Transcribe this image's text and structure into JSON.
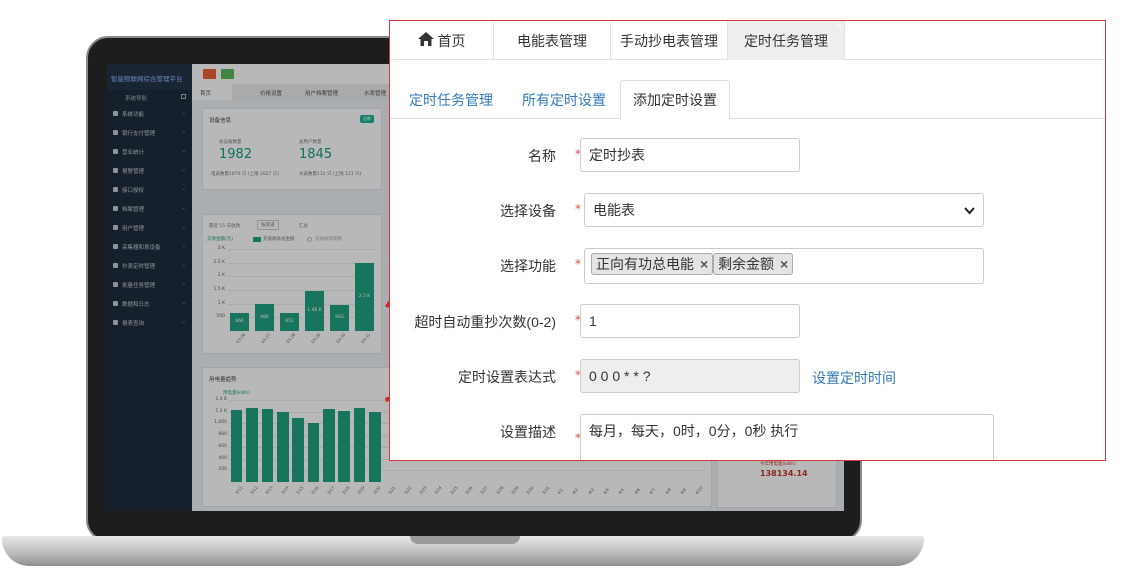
{
  "dashboard": {
    "brand": "智能物联网综合管理平台",
    "nav_header": "系统导航",
    "sidebar_items": [
      "系统功能",
      "银行支付管理",
      "营业统计",
      "报警管理",
      "接口授权",
      "档案管理",
      "用户管理",
      "采集器和表设备",
      "抄表定时管理",
      "批量任务管理",
      "数据和日志",
      "报表查询"
    ],
    "tabs": [
      "首页",
      "价格设置",
      "用户档案管理",
      "水表管理"
    ],
    "device_info": {
      "title": "设备信息",
      "badge": "总数",
      "total_devices_label": "总设备数量",
      "total_devices": "1982",
      "total_users_label": "总用户数量",
      "total_users": "1845",
      "meter_note": "电表数量1870 只 (上限 2027 只)",
      "water_note": "水表数量112 只 (上限 121 只)"
    },
    "recharge_chart": {
      "filter": "最近 15 天收款",
      "select": "按渠道",
      "summary": "汇总",
      "ylabel": "交易金额(元)",
      "legend_a": "充值收款总金额",
      "legend_b": "充值收款笔数",
      "yticks": [
        "3 K",
        "2.5 K",
        "2 K",
        "1.5 K",
        "1 K",
        "500"
      ]
    },
    "usage_chart": {
      "title": "用电量趋势",
      "ylabel": "用电量(kWh)",
      "yticks": [
        "1.4 K",
        "1.2 K",
        "1,000",
        "800",
        "600",
        "400",
        "200"
      ],
      "total_label": "今年用电量(kWh)",
      "total_value": "138134.14"
    }
  },
  "chart_data": [
    {
      "type": "bar",
      "categories": [
        "03-26",
        "03-27",
        "03-28",
        "03-29",
        "03-30",
        "03-31"
      ],
      "values": [
        666,
        986,
        651,
        1460,
        963,
        2500
      ],
      "ylabel": "交易金额(元)",
      "ylim": [
        0,
        3000
      ]
    },
    {
      "type": "bar",
      "categories": [
        "3/11",
        "3/12",
        "3/13",
        "3/14",
        "3/15",
        "3/16",
        "3/17",
        "3/18",
        "3/19",
        "3/20",
        "3/21",
        "3/22",
        "3/23",
        "3/24",
        "3/25",
        "3/26",
        "3/27",
        "3/28",
        "3/29",
        "3/30",
        "3/31",
        "4/1",
        "4/2",
        "4/3",
        "4/4",
        "4/5",
        "4/6",
        "4/7",
        "4/8",
        "4/9",
        "4/10"
      ],
      "values": [
        1230,
        1260,
        1250,
        1200,
        1100,
        1000,
        1240,
        1220,
        1260,
        1200
      ],
      "ylabel": "用电量(kWh)",
      "ylim": [
        0,
        1400
      ]
    }
  ],
  "panel": {
    "top_tabs": [
      "首页",
      "电能表管理",
      "手动抄电表管理",
      "定时任务管理"
    ],
    "close": "×",
    "sub_tabs": [
      "定时任务管理",
      "所有定时设置",
      "添加定时设置"
    ],
    "form": {
      "name_label": "名称",
      "name_value": "定时抄表",
      "device_label": "选择设备",
      "device_value": "电能表",
      "function_label": "选择功能",
      "function_chips": [
        "正向有功总电能",
        "剩余金额"
      ],
      "chip_remove": "×",
      "retry_label": "超时自动重抄次数(0-2)",
      "retry_value": "1",
      "cron_label": "定时设置表达式",
      "cron_value": "0 0 0 * * ?",
      "cron_link": "设置定时时间",
      "desc_label": "设置描述",
      "desc_value": "每月，每天，0时，0分，0秒 执行"
    },
    "required_mark": "*"
  },
  "colors": {
    "accent_green": "#20a383",
    "sidebar_bg": "#1f2d3d",
    "panel_border": "#d23a3a",
    "link_blue": "#337ab7",
    "annotation_red": "#e02020"
  }
}
